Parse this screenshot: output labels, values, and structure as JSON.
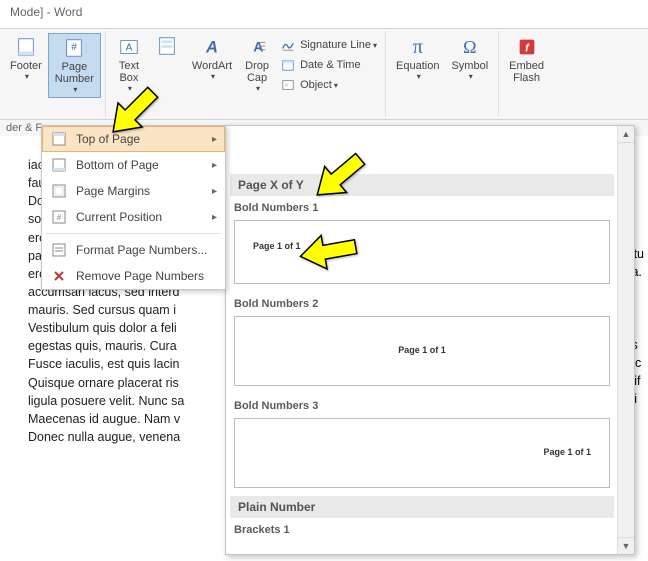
{
  "title_bar": "Mode] - Word",
  "status_strip": "der & F",
  "ribbon": {
    "footer": "Footer",
    "page_number": "Page\nNumber",
    "text_box": "Text\nBox",
    "quick_parts": "",
    "wordart": "WordArt",
    "drop_cap": "Drop\nCap",
    "signature": "Signature Line",
    "date_time": "Date & Time",
    "object": "Object",
    "equation": "Equation",
    "symbol": "Symbol",
    "embed_flash": "Embed\nFlash"
  },
  "menu": {
    "top": "Top of Page",
    "bottom": "Bottom of Page",
    "margins": "Page Margins",
    "current": "Current Position",
    "format": "Format Page Numbers...",
    "remove": "Remove Page Numbers"
  },
  "gallery": {
    "section1_header": "Page X of Y",
    "bold1_title": "Bold Numbers 1",
    "bold1_sample": "Page 1 of 1",
    "bold2_title": "Bold Numbers 2",
    "bold2_sample": "Page 1 of 1",
    "bold3_title": "Bold Numbers 3",
    "bold3_sample": "Page 1 of 1",
    "section2_header": "Plain Number",
    "brackets1_title": "Brackets 1"
  },
  "body_text": "iaculis nibh, vitae scelerisq\nfaucibus at, quam.\nDonec elit est, consectetue\nsociosqu ad litora torquent\neros. Fusce in sapien eu pu\nparturient montes, nascetur\neros. Etiam at ligula et tellu\naccumsan lacus, sed interd\nmauris. Sed cursus quam i\nVestibulum quis dolor a feli\negestas quis, mauris. Cura\nFusce iaculis, est quis lacin\nQuisque ornare placerat ris\nligula posuere velit. Nunc sa\nMaecenas id augue. Nam v\nDonec nulla augue, venena",
  "body_right_text": "ctu\nra.\na\ns\ng\nrs\nr c\neif\ndi\n\nr"
}
